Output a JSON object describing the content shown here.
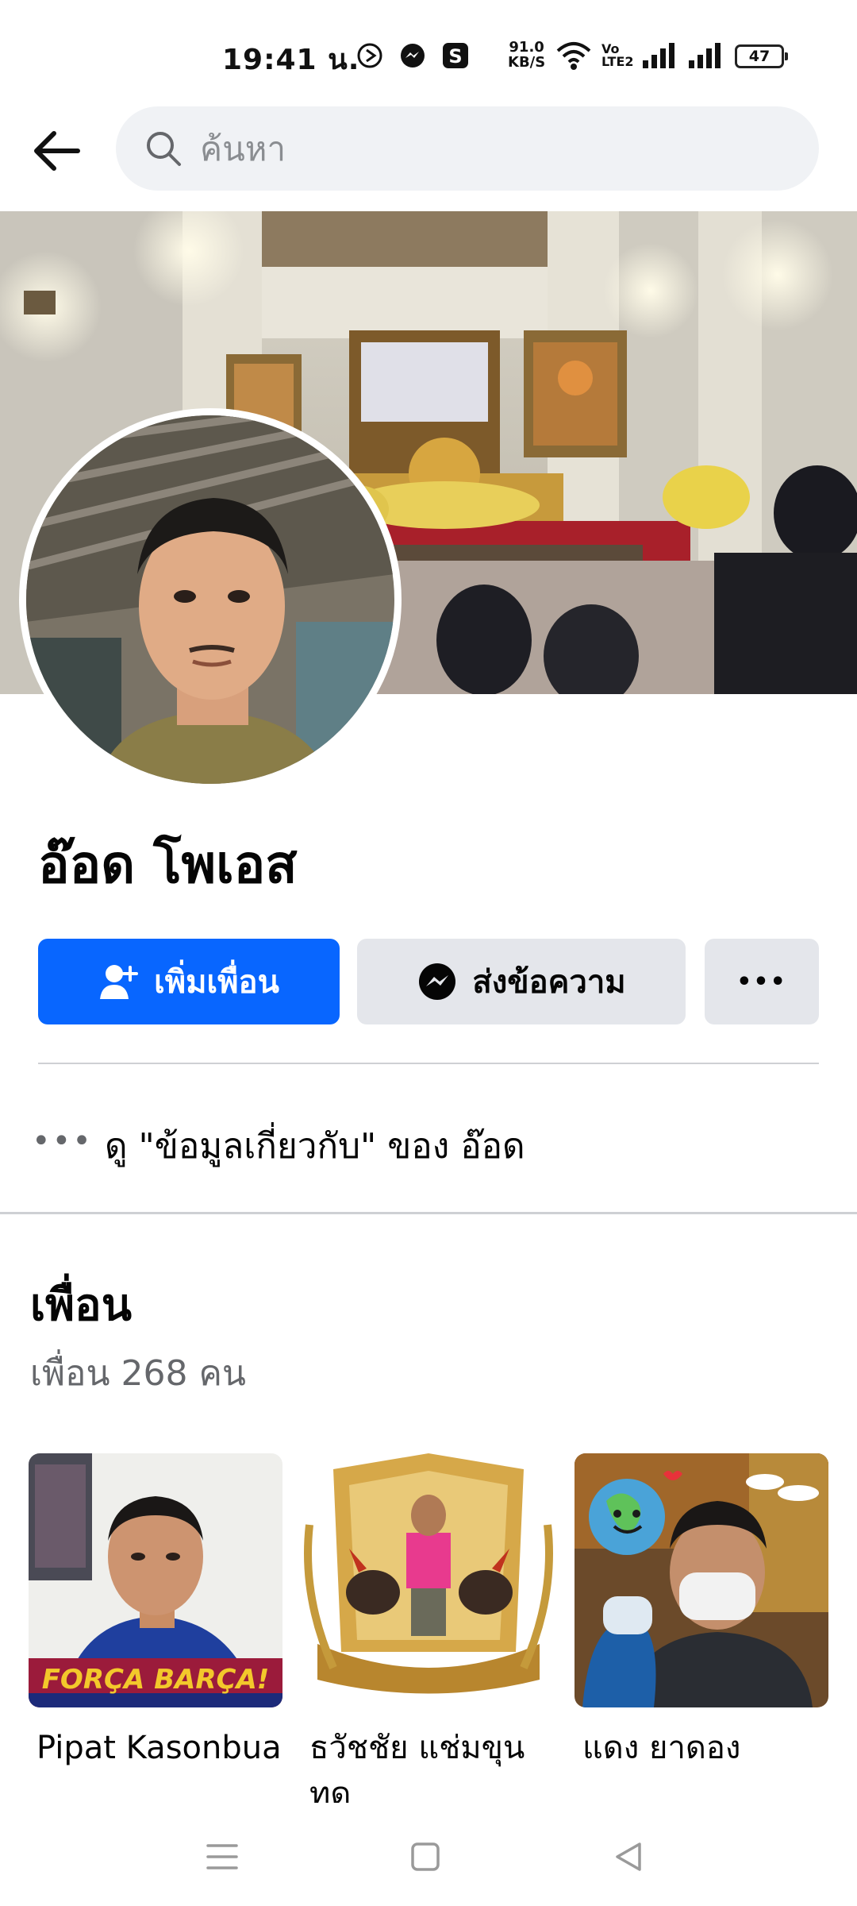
{
  "status_bar": {
    "time": "19:41 น.",
    "net_speed_value": "91.0",
    "net_speed_unit": "KB/S",
    "volte_top": "Vo",
    "volte_bottom": "LTE2",
    "battery": "47"
  },
  "header": {
    "search_placeholder": "ค้นหา"
  },
  "profile": {
    "name": "อ๊อด โพเอส",
    "add_friend_label": "เพิ่มเพื่อน",
    "message_label": "ส่งข้อความ",
    "more_label": "•••",
    "about_dots": "•••",
    "about_link": "ดู \"ข้อมูลเกี่ยวกับ\" ของ อ๊อด"
  },
  "friends": {
    "title": "เพื่อน",
    "count": "เพื่อน 268 คน",
    "items": [
      {
        "name": "Pipat Kasonbua",
        "banner": "FORÇA BARÇA!"
      },
      {
        "name": "ธวัชชัย แช่มขุนทด"
      },
      {
        "name": "แดง ยาดอง"
      }
    ]
  },
  "colors": {
    "primary": "#0866ff",
    "secondary_button": "#e4e6eb",
    "search_bg": "#f0f2f5",
    "muted_text": "#65676b"
  }
}
